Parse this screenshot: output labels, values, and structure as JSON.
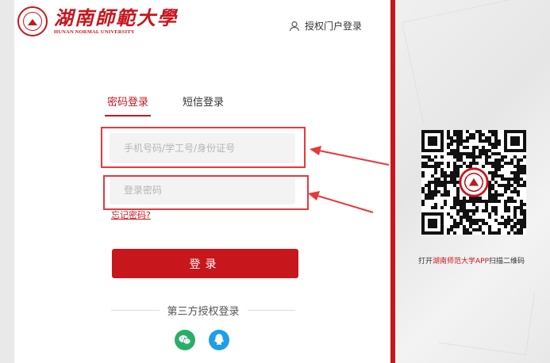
{
  "header": {
    "logo_cn": "湖南師範大學",
    "logo_en": "HUNAN NORMAL UNIVERSITY",
    "portal_login": "授权门户登录"
  },
  "tabs": [
    {
      "label": "密码登录",
      "active": true
    },
    {
      "label": "短信登录",
      "active": false
    }
  ],
  "form": {
    "username_placeholder": "手机号码/学工号/身份证号",
    "username_value": "",
    "password_placeholder": "登录密码",
    "password_value": "",
    "forgot_label": "忘记密码?",
    "login_label": "登录"
  },
  "third_party": {
    "label": "第三方授权登录",
    "providers": [
      "wechat-icon",
      "qq-icon"
    ]
  },
  "qr": {
    "caption_prefix": "打开",
    "caption_highlight": "湖南师范大学APP",
    "caption_suffix": "扫描二维码"
  },
  "colors": {
    "brand_red": "#c8161d",
    "highlight_red": "#e8383d",
    "wechat_green": "#2aae67",
    "qq_blue": "#1e9ee8"
  }
}
